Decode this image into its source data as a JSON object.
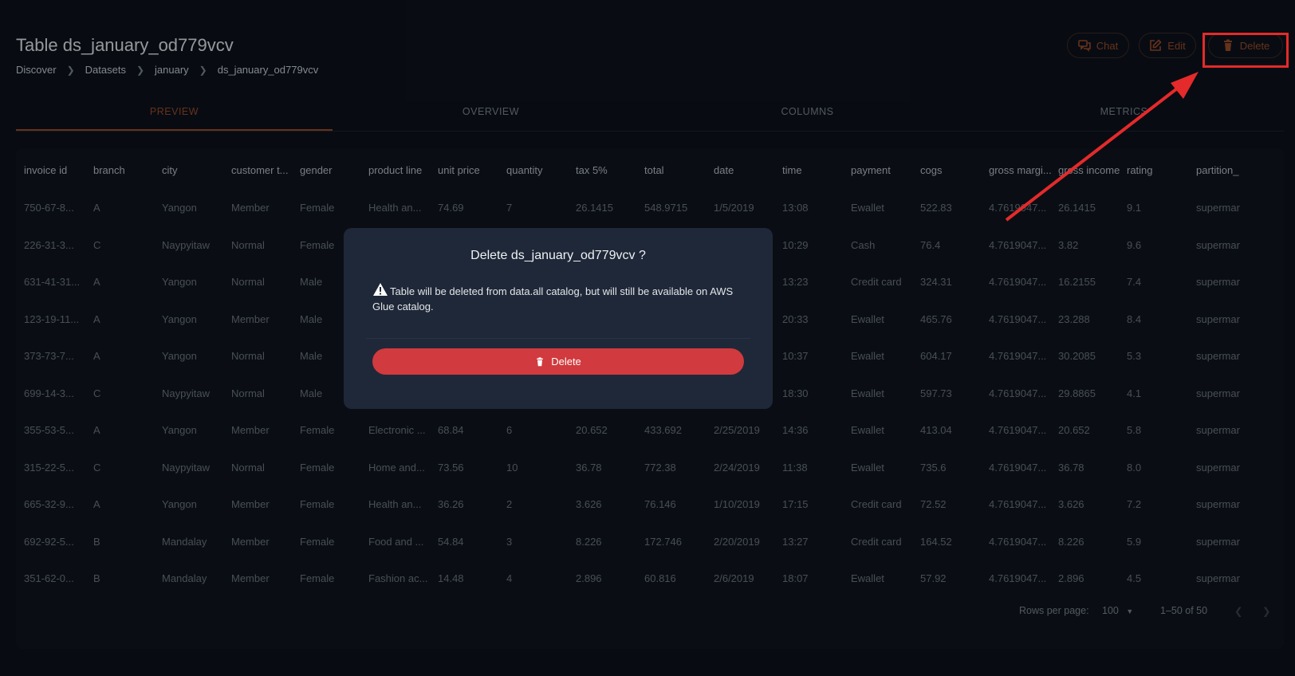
{
  "header": {
    "title": "Table ds_january_od779vcv",
    "breadcrumb": [
      "Discover",
      "Datasets",
      "january",
      "ds_january_od779vcv"
    ],
    "chat_label": "Chat",
    "edit_label": "Edit",
    "delete_label": "Delete"
  },
  "tabs": [
    "PREVIEW",
    "OVERVIEW",
    "COLUMNS",
    "METRICS"
  ],
  "table": {
    "columns": [
      "invoice id",
      "branch",
      "city",
      "customer t...",
      "gender",
      "product line",
      "unit price",
      "quantity",
      "tax 5%",
      "total",
      "date",
      "time",
      "payment",
      "cogs",
      "gross margi...",
      "gross income",
      "rating",
      "partition_"
    ],
    "rows": [
      [
        "750-67-8...",
        "A",
        "Yangon",
        "Member",
        "Female",
        "Health an...",
        "74.69",
        "7",
        "26.1415",
        "548.9715",
        "1/5/2019",
        "13:08",
        "Ewallet",
        "522.83",
        "4.7619047...",
        "26.1415",
        "9.1",
        "supermar"
      ],
      [
        "226-31-3...",
        "C",
        "Naypyitaw",
        "Normal",
        "Female",
        "",
        "",
        "",
        "",
        "",
        "9",
        "10:29",
        "Cash",
        "76.4",
        "4.7619047...",
        "3.82",
        "9.6",
        "supermar"
      ],
      [
        "631-41-31...",
        "A",
        "Yangon",
        "Normal",
        "Male",
        "",
        "",
        "",
        "",
        "",
        "9",
        "13:23",
        "Credit card",
        "324.31",
        "4.7619047...",
        "16.2155",
        "7.4",
        "supermar"
      ],
      [
        "123-19-11...",
        "A",
        "Yangon",
        "Member",
        "Male",
        "",
        "",
        "",
        "",
        "",
        "19",
        "20:33",
        "Ewallet",
        "465.76",
        "4.7619047...",
        "23.288",
        "8.4",
        "supermar"
      ],
      [
        "373-73-7...",
        "A",
        "Yangon",
        "Normal",
        "Male",
        "",
        "",
        "",
        "",
        "",
        "9",
        "10:37",
        "Ewallet",
        "604.17",
        "4.7619047...",
        "30.2085",
        "5.3",
        "supermar"
      ],
      [
        "699-14-3...",
        "C",
        "Naypyitaw",
        "Normal",
        "Male",
        "",
        "",
        "",
        "",
        "",
        "019",
        "18:30",
        "Ewallet",
        "597.73",
        "4.7619047...",
        "29.8865",
        "4.1",
        "supermar"
      ],
      [
        "355-53-5...",
        "A",
        "Yangon",
        "Member",
        "Female",
        "Electronic ...",
        "68.84",
        "6",
        "20.652",
        "433.692",
        "2/25/2019",
        "14:36",
        "Ewallet",
        "413.04",
        "4.7619047...",
        "20.652",
        "5.8",
        "supermar"
      ],
      [
        "315-22-5...",
        "C",
        "Naypyitaw",
        "Normal",
        "Female",
        "Home and...",
        "73.56",
        "10",
        "36.78",
        "772.38",
        "2/24/2019",
        "11:38",
        "Ewallet",
        "735.6",
        "4.7619047...",
        "36.78",
        "8.0",
        "supermar"
      ],
      [
        "665-32-9...",
        "A",
        "Yangon",
        "Member",
        "Female",
        "Health an...",
        "36.26",
        "2",
        "3.626",
        "76.146",
        "1/10/2019",
        "17:15",
        "Credit card",
        "72.52",
        "4.7619047...",
        "3.626",
        "7.2",
        "supermar"
      ],
      [
        "692-92-5...",
        "B",
        "Mandalay",
        "Member",
        "Female",
        "Food and ...",
        "54.84",
        "3",
        "8.226",
        "172.746",
        "2/20/2019",
        "13:27",
        "Credit card",
        "164.52",
        "4.7619047...",
        "8.226",
        "5.9",
        "supermar"
      ],
      [
        "351-62-0...",
        "B",
        "Mandalay",
        "Member",
        "Female",
        "Fashion ac...",
        "14.48",
        "4",
        "2.896",
        "60.816",
        "2/6/2019",
        "18:07",
        "Ewallet",
        "57.92",
        "4.7619047...",
        "2.896",
        "4.5",
        "supermar"
      ]
    ]
  },
  "pagination": {
    "rows_per_page_label": "Rows per page:",
    "rows_per_page": "100",
    "range": "1–50 of 50"
  },
  "dialog": {
    "title": "Delete ds_january_od779vcv ?",
    "message": "Table will be deleted from data.all catalog, but will still be available on AWS Glue catalog.",
    "delete_label": "Delete"
  },
  "colors": {
    "accent": "#9b4a26",
    "danger": "#d13a3e",
    "annotation": "#e42a2a"
  }
}
